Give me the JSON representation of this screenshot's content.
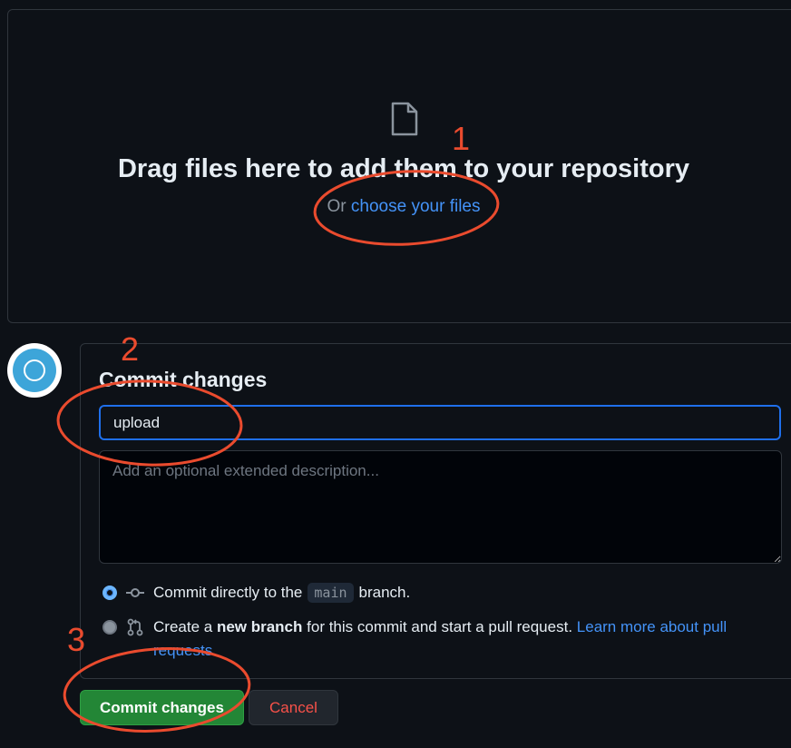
{
  "dropzone": {
    "title": "Drag files here to add them to your repository",
    "sub_prefix": "Or",
    "choose_link": "choose your files"
  },
  "commit": {
    "title": "Commit changes",
    "summary_value": "upload",
    "description_placeholder": "Add an optional extended description...",
    "option_direct": {
      "prefix": "Commit directly to the",
      "branch": "main",
      "suffix": "branch."
    },
    "option_new": {
      "prefix": "Create a",
      "bold": "new branch",
      "middle": "for this commit and start a pull request.",
      "link_line1": "Learn more about pull",
      "link_line2": "requests."
    }
  },
  "buttons": {
    "commit": "Commit changes",
    "cancel": "Cancel"
  },
  "annotations": {
    "labels": [
      "1",
      "2",
      "3"
    ],
    "color": "#ea4b2e"
  },
  "colors": {
    "background": "#0d1117",
    "link": "#4493f8",
    "commit_button": "#238636",
    "cancel_text": "#f85149",
    "focus_border": "#1f6feb"
  }
}
